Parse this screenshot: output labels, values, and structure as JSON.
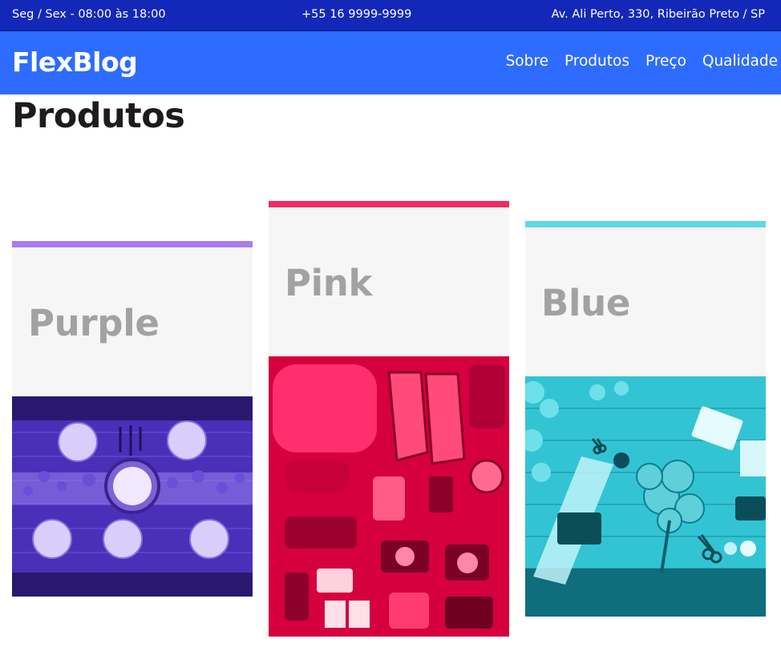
{
  "topbar": {
    "hours": "Seg / Sex - 08:00 às 18:00",
    "phone": "+55 16 9999-9999",
    "address": "Av. Ali Perto, 330, Ribeirão Preto / SP",
    "background": "#1328b8"
  },
  "header": {
    "logo": "FlexBlog",
    "background": "#2d6cff",
    "nav": [
      "Sobre",
      "Produtos",
      "Preço",
      "Qualidade"
    ]
  },
  "main": {
    "title": "Produtos",
    "cards": [
      {
        "title": "Purple",
        "accent": "#a97cf0",
        "photo_tint": "#5b3fd6",
        "photo_icon": "dinner-table-photo"
      },
      {
        "title": "Pink",
        "accent": "#ee2d64",
        "photo_tint": "#e0004a",
        "photo_icon": "travel-gear-photo"
      },
      {
        "title": "Blue",
        "accent": "#5fd8e6",
        "photo_tint": "#24b8c8",
        "photo_icon": "flowers-desk-photo"
      }
    ]
  }
}
